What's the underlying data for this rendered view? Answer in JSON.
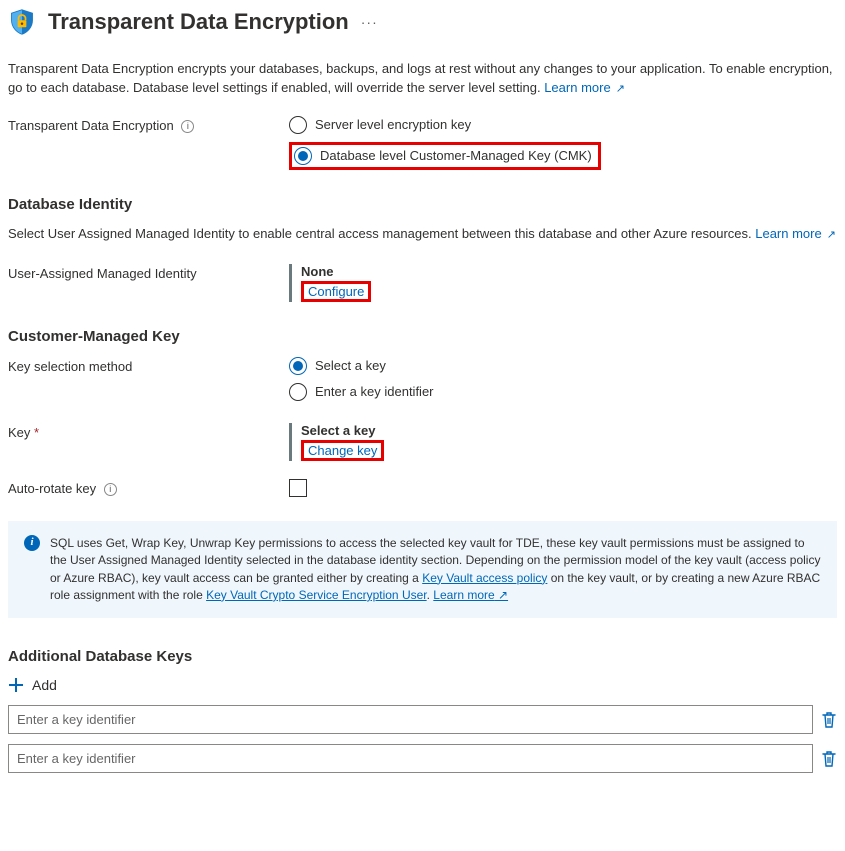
{
  "header": {
    "title": "Transparent Data Encryption"
  },
  "intro": {
    "text": "Transparent Data Encryption encrypts your databases, backups, and logs at rest without any changes to your application. To enable encryption, go to each database. Database level settings if enabled, will override the server level setting. ",
    "learn_more": "Learn more"
  },
  "tde": {
    "label": "Transparent Data Encryption",
    "option_server": "Server level encryption key",
    "option_db": "Database level Customer-Managed Key (CMK)"
  },
  "db_identity": {
    "heading": "Database Identity",
    "desc": "Select User Assigned Managed Identity to enable central access management between this database and other Azure resources. ",
    "learn_more": "Learn more",
    "uami_label": "User-Assigned Managed Identity",
    "uami_value": "None",
    "configure": "Configure"
  },
  "cmk": {
    "heading": "Customer-Managed Key",
    "method_label": "Key selection method",
    "method_select": "Select a key",
    "method_identifier": "Enter a key identifier",
    "key_label": "Key",
    "key_value": "Select a key",
    "change_key": "Change key",
    "autorotate_label": "Auto-rotate key"
  },
  "infobox": {
    "text1": "SQL uses Get, Wrap Key, Unwrap Key permissions to access the selected key vault for TDE, these key vault permissions must be assigned to the User Assigned Managed Identity selected in the database identity section. Depending on the permission model of the key vault (access policy or Azure RBAC), key vault access can be granted either by creating a ",
    "link1": "Key Vault access policy",
    "text2": " on the key vault, or by creating a new Azure RBAC role assignment with the role ",
    "link2": "Key Vault Crypto Service Encryption User",
    "learn_more": "Learn more"
  },
  "additional": {
    "heading": "Additional Database Keys",
    "add": "Add",
    "placeholder": "Enter a key identifier"
  }
}
